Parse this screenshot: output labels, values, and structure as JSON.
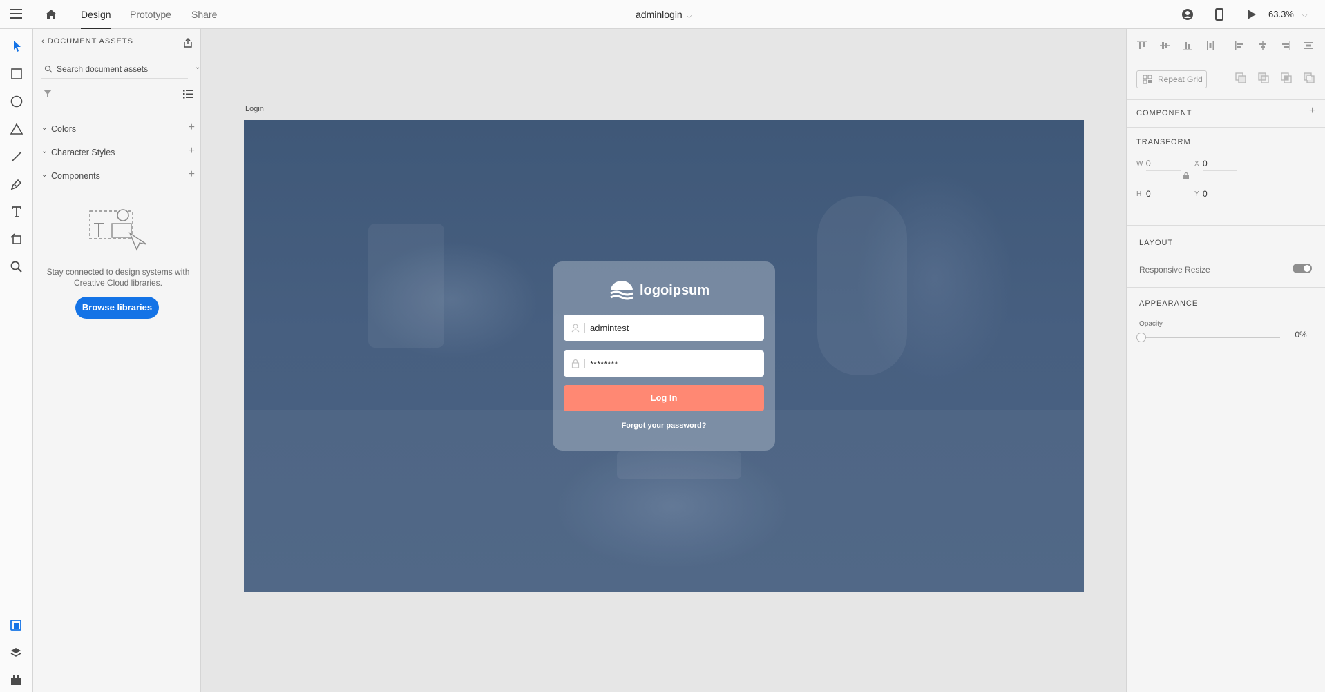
{
  "topbar": {
    "tabs": [
      {
        "label": "Design",
        "active": true
      },
      {
        "label": "Prototype",
        "active": false
      },
      {
        "label": "Share",
        "active": false
      }
    ],
    "document_title": "adminlogin",
    "zoom": "63.3%"
  },
  "toolbar": {
    "tools": [
      "select-icon",
      "rectangle-icon",
      "ellipse-icon",
      "polygon-icon",
      "line-icon",
      "pen-icon",
      "text-icon",
      "artboard-icon",
      "zoom-icon"
    ],
    "bottom": [
      "assets-icon",
      "layers-icon",
      "plugins-icon"
    ]
  },
  "assets": {
    "header": "DOCUMENT ASSETS",
    "search_placeholder": "Search document assets",
    "sections": [
      {
        "label": "Colors"
      },
      {
        "label": "Character Styles"
      },
      {
        "label": "Components"
      }
    ],
    "empty_text": "Stay connected to design systems with Creative Cloud libraries.",
    "browse_button": "Browse libraries"
  },
  "canvas": {
    "artboard_label": "Login",
    "login": {
      "logo_text": "logoipsum",
      "username": "admintest",
      "password": "********",
      "button": "Log In",
      "forgot": "Forgot your password?"
    }
  },
  "props": {
    "repeat_grid": "Repeat Grid",
    "component_title": "COMPONENT",
    "transform_title": "TRANSFORM",
    "w_label": "W",
    "w": "0",
    "h_label": "H",
    "h": "0",
    "x_label": "X",
    "x": "0",
    "y_label": "Y",
    "y": "0",
    "layout_title": "LAYOUT",
    "responsive_resize": "Responsive Resize",
    "appearance_title": "APPEARANCE",
    "opacity_label": "Opacity",
    "opacity_value": "0%"
  },
  "colors": {
    "accent": "#1473e6",
    "login_button": "#ff8873",
    "artboard_overlay": "#3f5878"
  }
}
